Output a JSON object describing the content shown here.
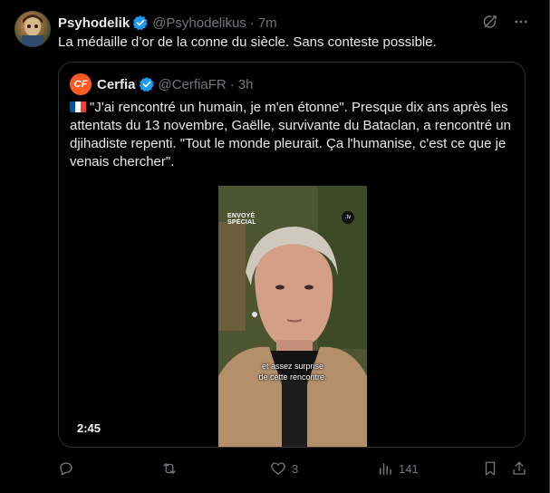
{
  "tweet": {
    "display_name": "Psyhodelik",
    "handle": "@Psyhodelikus",
    "separator": "·",
    "time": "7m",
    "text": "La médaille d’or de la conne du siècle. Sans conteste possible."
  },
  "quote": {
    "avatar_letters": "CF",
    "display_name": "Cerfia",
    "handle": "@CerfiaFR",
    "separator": "·",
    "time": "3h",
    "text": "\"J'ai rencontré un humain, je m'en étonne\". Presque dix ans après les attentats du 13 novembre, Gaëlle, survivante du Bataclan, a rencontré un djihadiste repenti. \"Tout le monde pleurait. Ça l'humanise, c'est ce que je venais chercher\".",
    "video": {
      "duration": "2:45",
      "logo_line1": "ENVOYÉ",
      "logo_line2": "SPÉCIAL",
      "channel_badge": ".tv",
      "subtitle_line1": "et assez surprise",
      "subtitle_line2": "de cette rencontre."
    }
  },
  "actions": {
    "reply_count": "",
    "retweet_count": "",
    "like_count": "3",
    "views_count": "141"
  },
  "icons": {
    "verified": "verified-badge-icon",
    "grok": "grok-icon",
    "more": "more-icon",
    "reply": "reply-icon",
    "retweet": "retweet-icon",
    "like": "heart-icon",
    "views": "views-icon",
    "bookmark": "bookmark-icon",
    "share": "share-icon"
  },
  "colors": {
    "background": "#000000",
    "text": "#e7e9ea",
    "muted": "#71767b",
    "border": "#2f3336",
    "verified": "#1d9bf0",
    "cerfia_orange": "#ff5a1f"
  }
}
